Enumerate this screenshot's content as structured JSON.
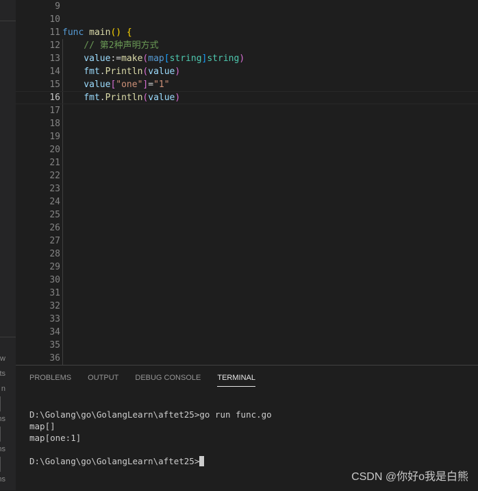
{
  "sidebar": {
    "fragments": [
      "w",
      "ts",
      "n",
      "ns",
      "ns",
      "ns"
    ]
  },
  "editor": {
    "first_line": 9,
    "last_line": 36,
    "current_line": 16,
    "lines": {
      "11": [
        [
          "k",
          "func "
        ],
        [
          "f",
          "main"
        ],
        [
          "b1",
          "() {"
        ]
      ],
      "12": [
        [
          "c",
          "    // 第2种声明方式"
        ]
      ],
      "13": [
        [
          "v",
          "    value"
        ],
        [
          "",
          ":="
        ],
        [
          "f",
          "make"
        ],
        [
          "b2",
          "("
        ],
        [
          "k",
          "map"
        ],
        [
          "b3",
          "["
        ],
        [
          "t",
          "string"
        ],
        [
          "b3",
          "]"
        ],
        [
          "t",
          "string"
        ],
        [
          "b2",
          ")"
        ]
      ],
      "14": [
        [
          "v",
          "    fmt"
        ],
        [
          "",
          "."
        ],
        [
          "f",
          "Println"
        ],
        [
          "b2",
          "("
        ],
        [
          "v",
          "value"
        ],
        [
          "b2",
          ")"
        ]
      ],
      "15": [
        [
          "v",
          "    value"
        ],
        [
          "b2",
          "["
        ],
        [
          "s",
          "\"one\""
        ],
        [
          "b2",
          "]"
        ],
        [
          "",
          "="
        ],
        [
          "s",
          "\"1\""
        ]
      ],
      "16": [
        [
          "v",
          "    fmt"
        ],
        [
          "",
          "."
        ],
        [
          "f",
          "Println"
        ],
        [
          "b2",
          "("
        ],
        [
          "v",
          "value"
        ],
        [
          "b2",
          ")"
        ]
      ]
    }
  },
  "panel": {
    "tabs": [
      "PROBLEMS",
      "OUTPUT",
      "DEBUG CONSOLE",
      "TERMINAL"
    ],
    "active_tab": "TERMINAL",
    "terminal": {
      "command_line": "D:\\Golang\\go\\GolangLearn\\aftet25>go run func.go",
      "output": [
        "map[]",
        "map[one:1]"
      ],
      "prompt": "D:\\Golang\\go\\GolangLearn\\aftet25>"
    }
  },
  "watermark": "CSDN @你好o我是白熊"
}
